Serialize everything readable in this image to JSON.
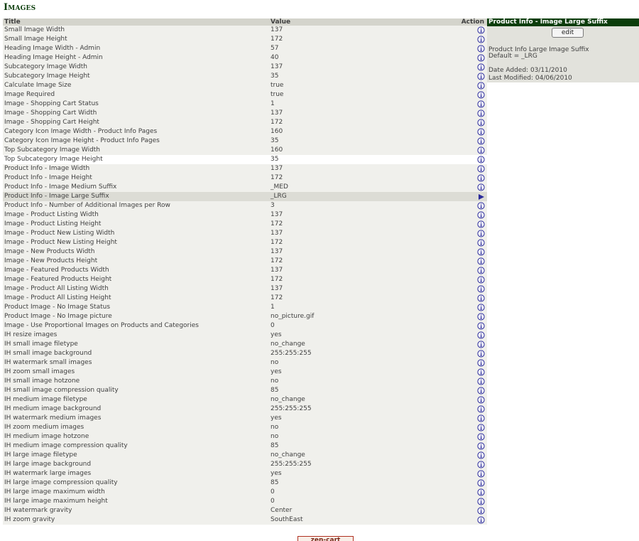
{
  "page_title": "Images",
  "table": {
    "headers": {
      "title": "Title",
      "value": "Value",
      "action": "Action"
    },
    "rows": [
      {
        "title": "Small Image Width",
        "value": "137",
        "action_icon": "info-icon"
      },
      {
        "title": "Small Image Height",
        "value": "172",
        "action_icon": "info-icon"
      },
      {
        "title": "Heading Image Width - Admin",
        "value": "57",
        "action_icon": "info-icon"
      },
      {
        "title": "Heading Image Height - Admin",
        "value": "40",
        "action_icon": "info-icon"
      },
      {
        "title": "Subcategory Image Width",
        "value": "137",
        "action_icon": "info-icon"
      },
      {
        "title": "Subcategory Image Height",
        "value": "35",
        "action_icon": "info-icon"
      },
      {
        "title": "Calculate Image Size",
        "value": "true",
        "action_icon": "info-icon"
      },
      {
        "title": "Image Required",
        "value": "true",
        "action_icon": "info-icon"
      },
      {
        "title": "Image - Shopping Cart Status",
        "value": "1",
        "action_icon": "info-icon"
      },
      {
        "title": "Image - Shopping Cart Width",
        "value": "137",
        "action_icon": "info-icon"
      },
      {
        "title": "Image - Shopping Cart Height",
        "value": "172",
        "action_icon": "info-icon"
      },
      {
        "title": "Category Icon Image Width - Product Info Pages",
        "value": "160",
        "action_icon": "info-icon"
      },
      {
        "title": "Category Icon Image Height - Product Info Pages",
        "value": "35",
        "action_icon": "info-icon"
      },
      {
        "title": "Top Subcategory Image Width",
        "value": "160",
        "action_icon": "info-icon"
      },
      {
        "title": "Top Subcategory Image Height",
        "value": "35",
        "action_icon": "info-icon",
        "style": "plain"
      },
      {
        "title": "Product Info - Image Width",
        "value": "137",
        "action_icon": "info-icon"
      },
      {
        "title": "Product Info - Image Height",
        "value": "172",
        "action_icon": "info-icon"
      },
      {
        "title": "Product Info - Image Medium Suffix",
        "value": "_MED",
        "action_icon": "info-icon"
      },
      {
        "title": "Product Info - Image Large Suffix",
        "value": "_LRG",
        "action_icon": "arrow-icon",
        "style": "selected"
      },
      {
        "title": "Product Info - Number of Additional Images per Row",
        "value": "3",
        "action_icon": "info-icon"
      },
      {
        "title": "Image - Product Listing Width",
        "value": "137",
        "action_icon": "info-icon"
      },
      {
        "title": "Image - Product Listing Height",
        "value": "172",
        "action_icon": "info-icon"
      },
      {
        "title": "Image - Product New Listing Width",
        "value": "137",
        "action_icon": "info-icon"
      },
      {
        "title": "Image - Product New Listing Height",
        "value": "172",
        "action_icon": "info-icon"
      },
      {
        "title": "Image - New Products Width",
        "value": "137",
        "action_icon": "info-icon"
      },
      {
        "title": "Image - New Products Height",
        "value": "172",
        "action_icon": "info-icon"
      },
      {
        "title": "Image - Featured Products Width",
        "value": "137",
        "action_icon": "info-icon"
      },
      {
        "title": "Image - Featured Products Height",
        "value": "172",
        "action_icon": "info-icon"
      },
      {
        "title": "Image - Product All Listing Width",
        "value": "137",
        "action_icon": "info-icon"
      },
      {
        "title": "Image - Product All Listing Height",
        "value": "172",
        "action_icon": "info-icon"
      },
      {
        "title": "Product Image - No Image Status",
        "value": "1",
        "action_icon": "info-icon"
      },
      {
        "title": "Product Image - No Image picture",
        "value": "no_picture.gif",
        "action_icon": "info-icon"
      },
      {
        "title": "Image - Use Proportional Images on Products and Categories",
        "value": "0",
        "action_icon": "info-icon"
      },
      {
        "title": "IH resize images",
        "value": "yes",
        "action_icon": "info-icon"
      },
      {
        "title": "IH small image filetype",
        "value": "no_change",
        "action_icon": "info-icon"
      },
      {
        "title": "IH small image background",
        "value": "255:255:255",
        "action_icon": "info-icon"
      },
      {
        "title": "IH watermark small images",
        "value": "no",
        "action_icon": "info-icon"
      },
      {
        "title": "IH zoom small images",
        "value": "yes",
        "action_icon": "info-icon"
      },
      {
        "title": "IH small image hotzone",
        "value": "no",
        "action_icon": "info-icon"
      },
      {
        "title": "IH small image compression quality",
        "value": "85",
        "action_icon": "info-icon"
      },
      {
        "title": "IH medium image filetype",
        "value": "no_change",
        "action_icon": "info-icon"
      },
      {
        "title": "IH medium image background",
        "value": "255:255:255",
        "action_icon": "info-icon"
      },
      {
        "title": "IH watermark medium images",
        "value": "yes",
        "action_icon": "info-icon"
      },
      {
        "title": "IH zoom medium images",
        "value": "no",
        "action_icon": "info-icon"
      },
      {
        "title": "IH medium image hotzone",
        "value": "no",
        "action_icon": "info-icon"
      },
      {
        "title": "IH medium image compression quality",
        "value": "85",
        "action_icon": "info-icon"
      },
      {
        "title": "IH large image filetype",
        "value": "no_change",
        "action_icon": "info-icon"
      },
      {
        "title": "IH large image background",
        "value": "255:255:255",
        "action_icon": "info-icon"
      },
      {
        "title": "IH watermark large images",
        "value": "yes",
        "action_icon": "info-icon"
      },
      {
        "title": "IH large image compression quality",
        "value": "85",
        "action_icon": "info-icon"
      },
      {
        "title": "IH large image maximum width",
        "value": "0",
        "action_icon": "info-icon"
      },
      {
        "title": "IH large image maximum height",
        "value": "0",
        "action_icon": "info-icon"
      },
      {
        "title": "IH watermark gravity",
        "value": "Center",
        "action_icon": "info-icon"
      },
      {
        "title": "IH zoom gravity",
        "value": "SouthEast",
        "action_icon": "info-icon"
      }
    ]
  },
  "info_panel": {
    "header": "Product Info - Image Large Suffix",
    "edit_label": "edit",
    "description": "Product Info Large Image Suffix",
    "default_text": "Default = _LRG",
    "date_added": "Date Added: 03/11/2010",
    "last_modified": "Last Modified: 04/06/2010"
  },
  "footer": {
    "logo_text": "zen-cart",
    "logo_icon": "zen-cart-logo"
  },
  "colors": {
    "heading": "#0b3d0b",
    "header_bg": "#d4d4cc",
    "row_bg": "#f0f0ec",
    "selected_row_bg": "#dcdcd5",
    "panel_bg": "#e2e2dc",
    "icon_blue": "#2a2a9a"
  }
}
